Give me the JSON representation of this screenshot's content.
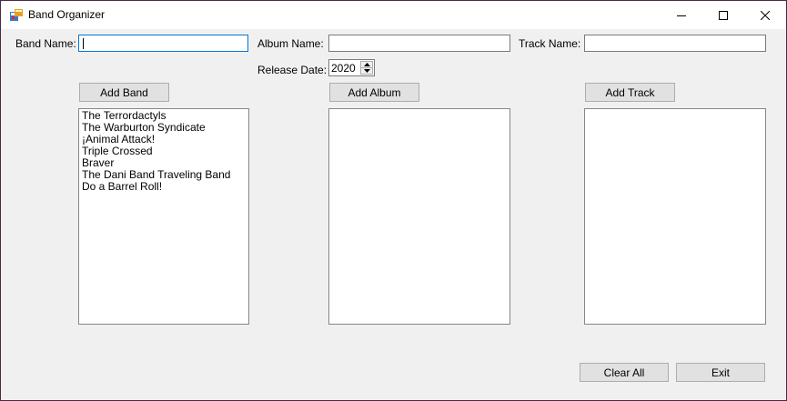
{
  "window": {
    "title": "Band Organizer",
    "controls": {
      "minimize": "minimize-icon",
      "maximize": "maximize-icon",
      "close": "close-icon"
    }
  },
  "form": {
    "band_name_label": "Band Name:",
    "band_name_value": "",
    "album_name_label": "Album Name:",
    "album_name_value": "",
    "track_name_label": "Track Name:",
    "track_name_value": "",
    "release_date_label": "Release Date:",
    "release_date_value": "2020"
  },
  "buttons": {
    "add_band": "Add Band",
    "add_album": "Add Album",
    "add_track": "Add Track",
    "clear_all": "Clear All",
    "exit": "Exit"
  },
  "lists": {
    "bands": [
      "The Terrordactyls",
      "The Warburton Syndicate",
      "¡Animal Attack!",
      "Triple Crossed",
      "Braver",
      "The Dani Band Traveling Band",
      "Do a Barrel Roll!"
    ],
    "albums": [],
    "tracks": []
  },
  "colors": {
    "focus_border": "#0078d7",
    "button_face": "#e1e1e1",
    "window_bg": "#f0f0f0"
  }
}
